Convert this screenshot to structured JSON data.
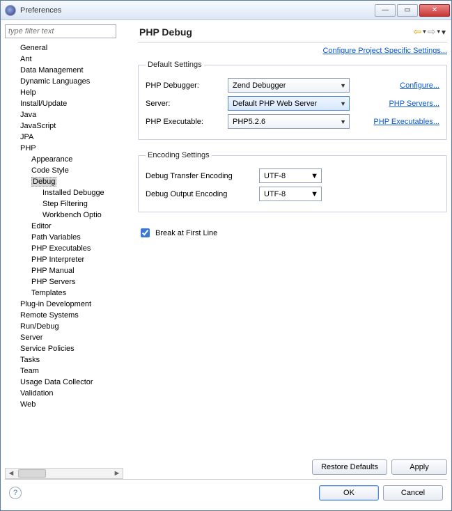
{
  "window": {
    "title": "Preferences"
  },
  "filter": {
    "placeholder": "type filter text"
  },
  "tree": {
    "items": [
      {
        "label": "General",
        "indent": 1
      },
      {
        "label": "Ant",
        "indent": 1
      },
      {
        "label": "Data Management",
        "indent": 1
      },
      {
        "label": "Dynamic Languages",
        "indent": 1
      },
      {
        "label": "Help",
        "indent": 1
      },
      {
        "label": "Install/Update",
        "indent": 1
      },
      {
        "label": "Java",
        "indent": 1
      },
      {
        "label": "JavaScript",
        "indent": 1
      },
      {
        "label": "JPA",
        "indent": 1
      },
      {
        "label": "PHP",
        "indent": 1
      },
      {
        "label": "Appearance",
        "indent": 2
      },
      {
        "label": "Code Style",
        "indent": 2
      },
      {
        "label": "Debug",
        "indent": 2,
        "selected": true
      },
      {
        "label": "Installed Debugge",
        "indent": 3
      },
      {
        "label": "Step Filtering",
        "indent": 3
      },
      {
        "label": "Workbench Optio",
        "indent": 3
      },
      {
        "label": "Editor",
        "indent": 2
      },
      {
        "label": "Path Variables",
        "indent": 2
      },
      {
        "label": "PHP Executables",
        "indent": 2
      },
      {
        "label": "PHP Interpreter",
        "indent": 2
      },
      {
        "label": "PHP Manual",
        "indent": 2
      },
      {
        "label": "PHP Servers",
        "indent": 2
      },
      {
        "label": "Templates",
        "indent": 2
      },
      {
        "label": "Plug-in Development",
        "indent": 1
      },
      {
        "label": "Remote Systems",
        "indent": 1
      },
      {
        "label": "Run/Debug",
        "indent": 1
      },
      {
        "label": "Server",
        "indent": 1
      },
      {
        "label": "Service Policies",
        "indent": 1
      },
      {
        "label": "Tasks",
        "indent": 1
      },
      {
        "label": "Team",
        "indent": 1
      },
      {
        "label": "Usage Data Collector",
        "indent": 1
      },
      {
        "label": "Validation",
        "indent": 1
      },
      {
        "label": "Web",
        "indent": 1
      }
    ]
  },
  "page": {
    "title": "PHP Debug",
    "config_link": "Configure Project Specific Settings...",
    "default_group": "Default Settings",
    "debugger_label": "PHP Debugger:",
    "debugger_value": "Zend Debugger",
    "debugger_link": "Configure...",
    "server_label": "Server:",
    "server_value": "Default PHP Web Server",
    "server_link": "PHP Servers...",
    "exe_label": "PHP Executable:",
    "exe_value": "PHP5.2.6",
    "exe_link": "PHP Executables...",
    "encoding_group": "Encoding Settings",
    "transfer_label": "Debug Transfer Encoding",
    "transfer_value": "UTF-8",
    "output_label": "Debug Output Encoding",
    "output_value": "UTF-8",
    "break_label": "Break at First Line",
    "break_checked": true,
    "restore": "Restore Defaults",
    "apply": "Apply"
  },
  "footer": {
    "ok": "OK",
    "cancel": "Cancel"
  }
}
